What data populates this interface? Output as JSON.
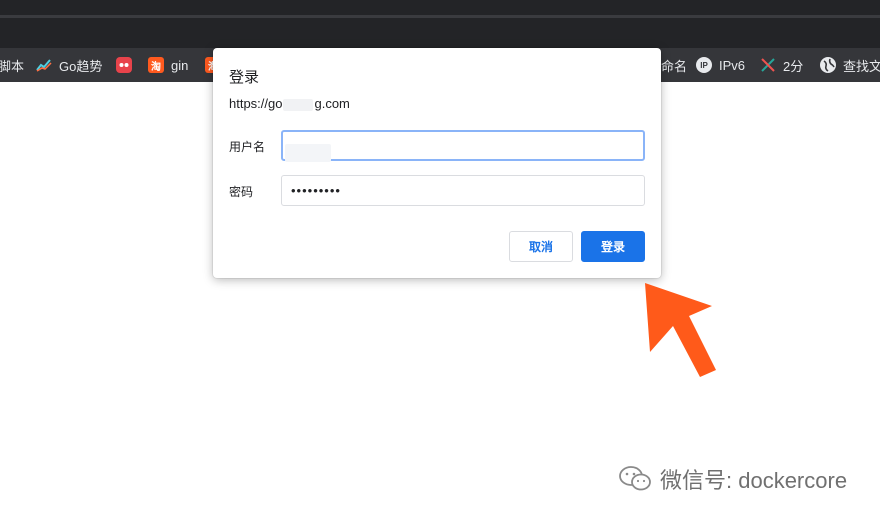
{
  "bookmarks": [
    {
      "label": "脚本",
      "icon": "bookmark-icon"
    },
    {
      "label": "Go趋势",
      "icon": "trend-chart-icon"
    },
    {
      "label": "",
      "icon": "red-logo-icon"
    },
    {
      "label": "gin",
      "icon": "taobao-icon"
    },
    {
      "label": "",
      "icon": "taobao-icon"
    },
    {
      "label": "命名",
      "icon": "bookmark-icon"
    },
    {
      "label": "IPv6",
      "icon": "ipv6-icon"
    },
    {
      "label": "2分",
      "icon": "stock-icon"
    },
    {
      "label": "查找文",
      "icon": "globe-icon"
    }
  ],
  "dialog": {
    "title": "登录",
    "url_prefix": "https://go",
    "url_suffix": "g.com",
    "username_label": "用户名",
    "username_value": "",
    "password_label": "密码",
    "password_value": "•••••••••",
    "cancel_label": "取消",
    "login_label": "登录"
  },
  "annotation": {
    "arrow_color": "#ff5a1a"
  },
  "watermark": {
    "text": "微信号: dockercore"
  }
}
